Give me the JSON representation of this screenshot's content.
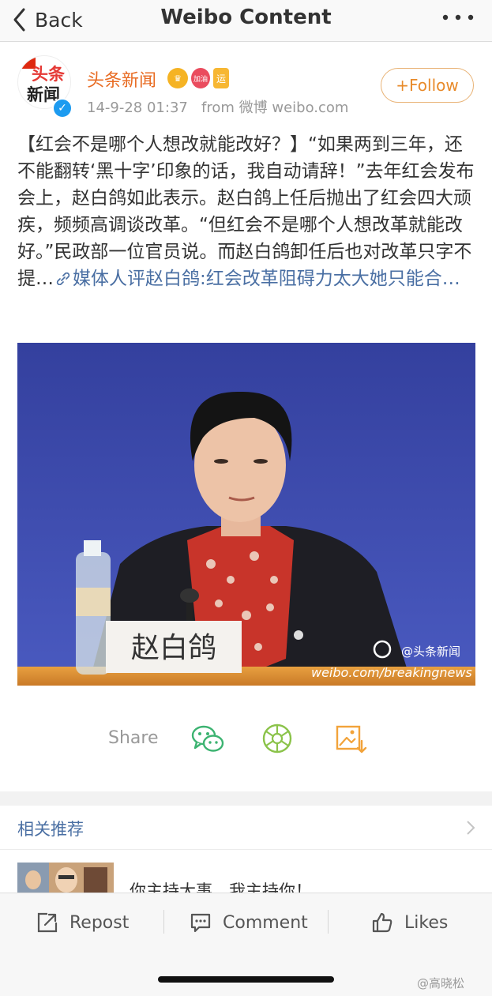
{
  "nav": {
    "back_label": "Back",
    "title": "Weibo Content"
  },
  "post": {
    "author": "头条新闻",
    "avatar_text_top": "头条",
    "avatar_text_bottom": "新闻",
    "badges": [
      "加油",
      "运"
    ],
    "timestamp": "14-9-28 01:37",
    "source": "from 微博 weibo.com",
    "follow_label": "+Follow",
    "text": "【红会不是哪个人想改就能改好？】“如果两到三年，还不能翻转‘黑十字’印象的话，我自动请辞！”去年红会发布会上，赵白鸽如此表示。赵白鸽上任后抛出了红会四大顽疾，频频高调谈改革。“但红会不是哪个人想改革就能改好。”民政部一位官员说。而赵白鸽卸任后也对改革只字不提…",
    "link_text": "媒体人评赵白鸽:红会改革阻碍力太大她只能合…",
    "image": {
      "nameplate": "赵白鸽",
      "watermark_handle": "@头条新闻",
      "watermark_url": "weibo.com/breakingnews"
    }
  },
  "share": {
    "label": "Share",
    "icons": [
      "wechat-icon",
      "moments-icon",
      "save-image-icon"
    ]
  },
  "related": {
    "title": "相关推荐",
    "headline": "你主持大事，我主持你！"
  },
  "bottom_bar": {
    "repost_label": "Repost",
    "comment_label": "Comment",
    "likes_label": "Likes"
  },
  "screenshot_watermark": "@高晓松",
  "colors": {
    "accent_orange": "#e86b22",
    "link_blue": "#4a6fa3",
    "wechat_green": "#3cb371",
    "moments_green": "#8bc34a",
    "save_orange": "#f2a33a",
    "photo_bg_blue": "#3c4aa8"
  }
}
